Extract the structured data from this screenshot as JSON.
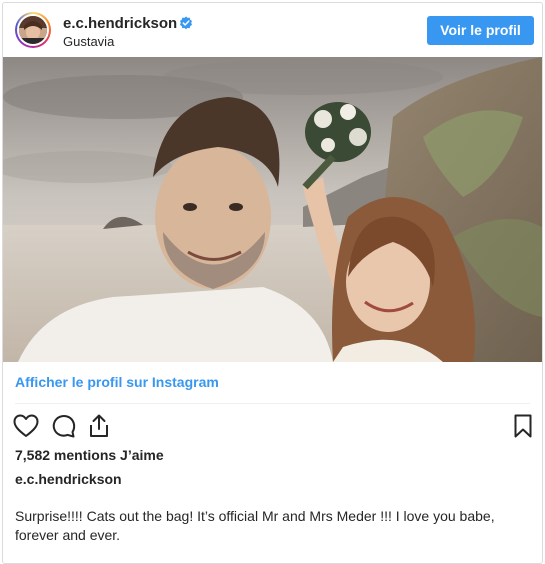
{
  "post": {
    "username": "e.c.hendrickson",
    "location": "Gustavia",
    "view_profile_button": "Voir le profil",
    "view_profile_link": "Afficher le profil sur Instagram",
    "likes": "7,582 mentions J’aime",
    "caption_username": "e.c.hendrickson",
    "caption": "Surprise!!!! Cats out the bag! It’s official Mr and Mrs Meder !!! I love you babe, forever and ever."
  },
  "icons": {
    "verified": "verified-badge-icon",
    "like": "heart-icon",
    "comment": "comment-bubble-icon",
    "share": "share-icon",
    "save": "bookmark-icon"
  },
  "colors": {
    "accent": "#3897f0",
    "text": "#262626",
    "border": "#dbdbdb"
  }
}
